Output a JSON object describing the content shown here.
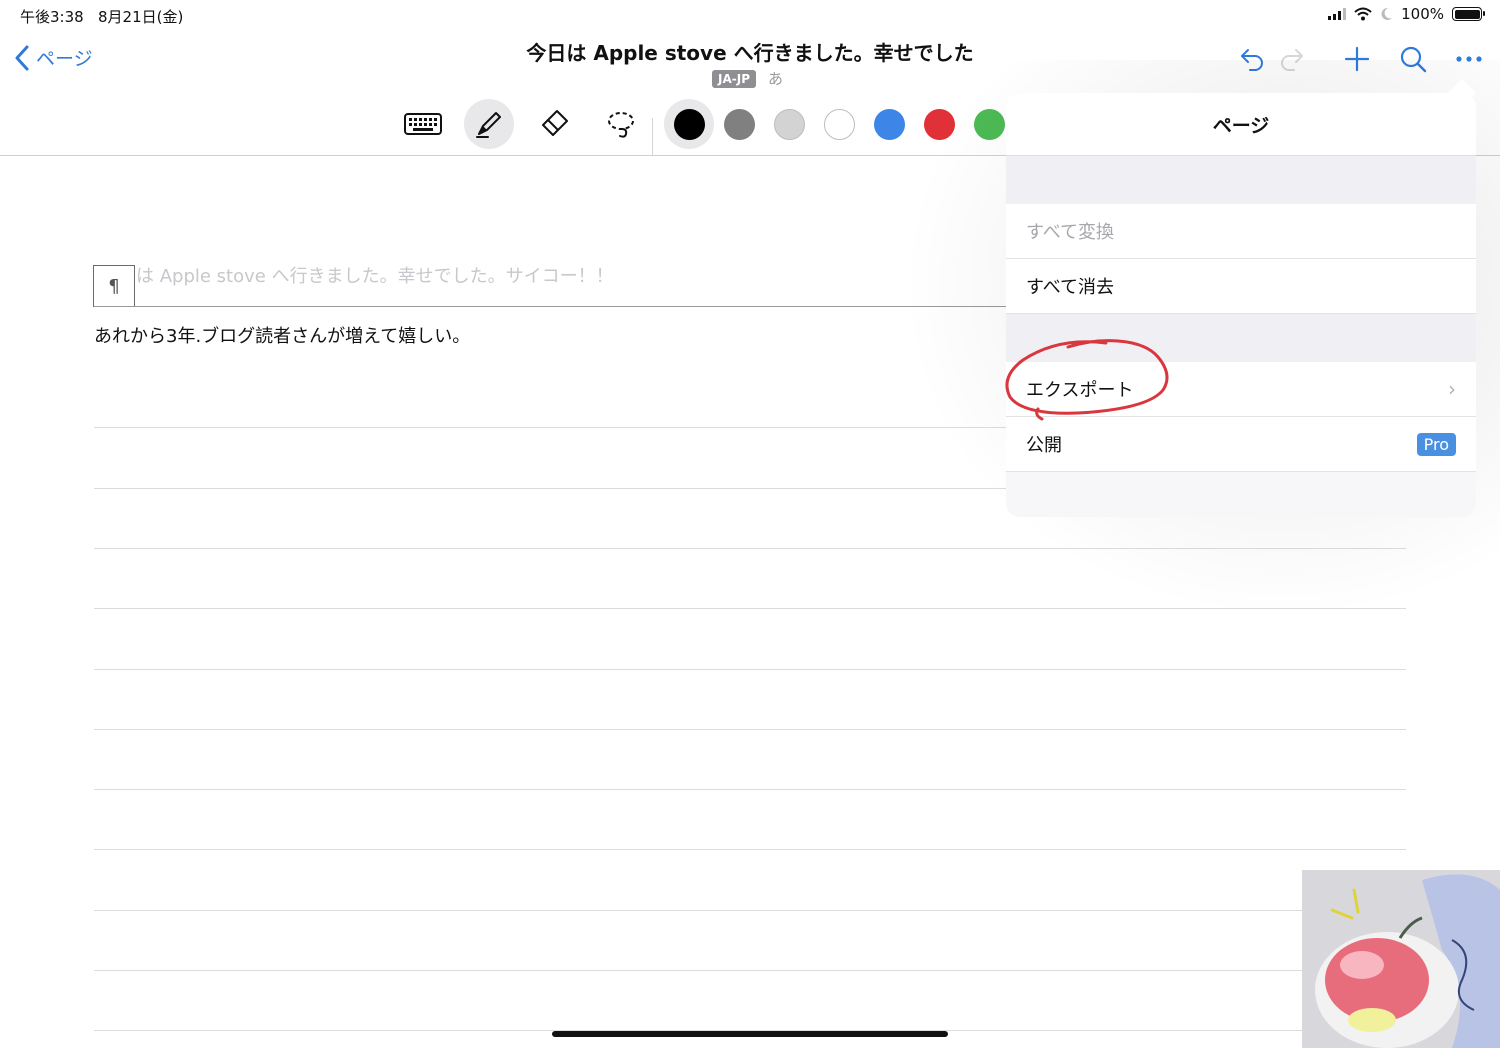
{
  "status_bar": {
    "time": "午後3:38",
    "date": "8月21日(金)",
    "battery": "100%"
  },
  "nav": {
    "back_label": "ページ",
    "title": "今日は Apple stove へ行きました。幸せでした",
    "lang_badge": "JA-JP",
    "input_hiragana": "あ",
    "icons": [
      "undo-icon",
      "redo-icon",
      "add-icon",
      "search-icon",
      "more-icon"
    ]
  },
  "toolbar": {
    "tools": [
      "keyboard-icon",
      "pen-icon",
      "eraser-icon",
      "lasso-icon"
    ],
    "active_tool": "pen-icon",
    "colors": [
      "#000000",
      "#808080",
      "#d3d3d3",
      "#ffffff",
      "#3d86e8",
      "#e03038",
      "#4cba54"
    ],
    "selected_color": "#000000"
  },
  "document": {
    "paragraph_mark": "¶",
    "faint_line": "は Apple stove へ行きました。幸せでした。サイコー！！",
    "body_text": "あれから3年.ブログ読者さんが増えて嬉しい。"
  },
  "popover": {
    "title": "ページ",
    "items": [
      {
        "label": "すべて変換",
        "disabled": true
      },
      {
        "label": "すべて消去",
        "disabled": false
      },
      {
        "label": "エクスポート",
        "chevron": "›",
        "annotated": true
      },
      {
        "label": "公開",
        "badge": "Pro"
      }
    ],
    "annotation_color": "#d9363e"
  },
  "accent_color": "#2f7bd9"
}
